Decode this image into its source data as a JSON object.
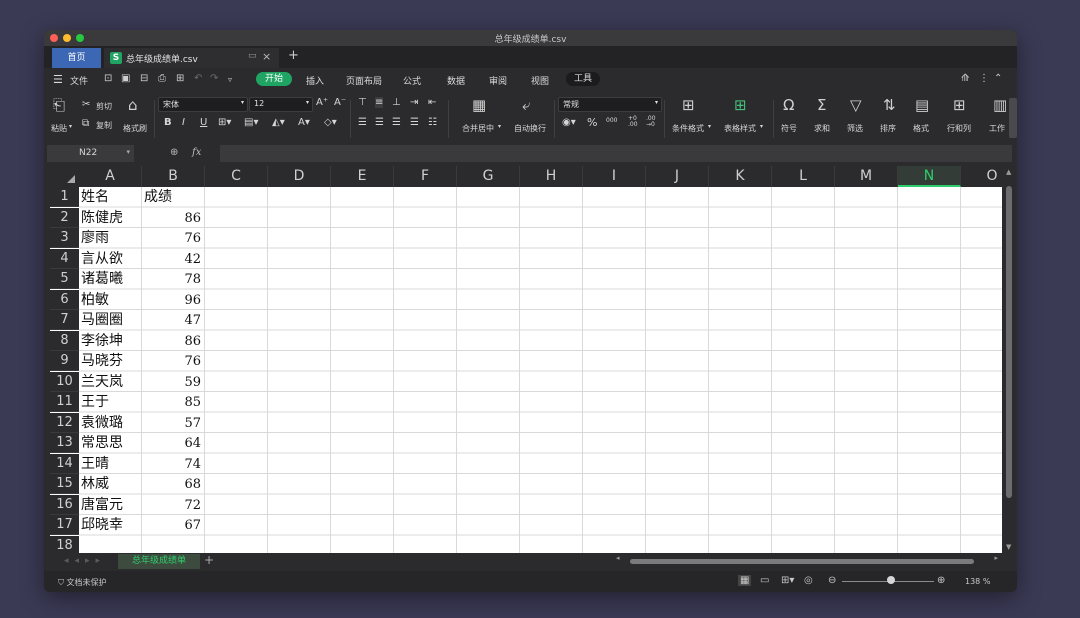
{
  "window": {
    "title": "总年级成绩单.csv"
  },
  "tabs": {
    "home": "首页",
    "doc": "总年级成绩单.csv",
    "doc_icon": "S"
  },
  "menu": {
    "file": "文件",
    "items": [
      "开始",
      "插入",
      "页面布局",
      "公式",
      "数据",
      "审阅",
      "视图",
      "工具"
    ]
  },
  "ribbon": {
    "paste": "粘贴",
    "cut": "剪切",
    "copy": "复制",
    "format_painter": "格式刷",
    "font_name": "宋体",
    "font_size": "12",
    "merge_center": "合并居中",
    "wrap_text": "自动换行",
    "number_format": "常规",
    "percent": "%",
    "thousands": "000",
    "cond_format": "条件格式",
    "table_style": "表格样式",
    "symbol": "符号",
    "sum": "求和",
    "filter": "筛选",
    "sort": "排序",
    "format": "格式",
    "row_col": "行和列",
    "worksheet": "工作"
  },
  "formula_bar": {
    "cell_ref": "N22",
    "fx": "fx",
    "value": ""
  },
  "grid": {
    "columns": [
      "A",
      "B",
      "C",
      "D",
      "E",
      "F",
      "G",
      "H",
      "I",
      "J",
      "K",
      "L",
      "M",
      "N",
      "O"
    ],
    "selected_column": "N",
    "rows": [
      "1",
      "2",
      "3",
      "4",
      "5",
      "6",
      "7",
      "8",
      "9",
      "10",
      "11",
      "12",
      "13",
      "14",
      "15",
      "16",
      "17",
      "18"
    ],
    "header": {
      "name": "姓名",
      "score": "成绩"
    },
    "records": [
      {
        "name": "陈健虎",
        "score": "86"
      },
      {
        "name": "廖雨",
        "score": "76"
      },
      {
        "name": "言从欲",
        "score": "42"
      },
      {
        "name": "诸葛曦",
        "score": "78"
      },
      {
        "name": "柏敏",
        "score": "96"
      },
      {
        "name": "马圈圈",
        "score": "47"
      },
      {
        "name": "李徐坤",
        "score": "86"
      },
      {
        "name": "马晓芬",
        "score": "76"
      },
      {
        "name": "兰天岚",
        "score": "59"
      },
      {
        "name": "王于",
        "score": "85"
      },
      {
        "name": "袁微璐",
        "score": "57"
      },
      {
        "name": "常思思",
        "score": "64"
      },
      {
        "name": "王晴",
        "score": "74"
      },
      {
        "name": "林威",
        "score": "68"
      },
      {
        "name": "唐富元",
        "score": "72"
      },
      {
        "name": "邱晓幸",
        "score": "67"
      }
    ]
  },
  "sheet": {
    "name": "总年级成绩单"
  },
  "status": {
    "protection": "文档未保护",
    "zoom": "138 %"
  },
  "colors": {
    "accent": "#1fa463",
    "home_tab": "#3c67b4",
    "selected": "#2ecf6b"
  }
}
